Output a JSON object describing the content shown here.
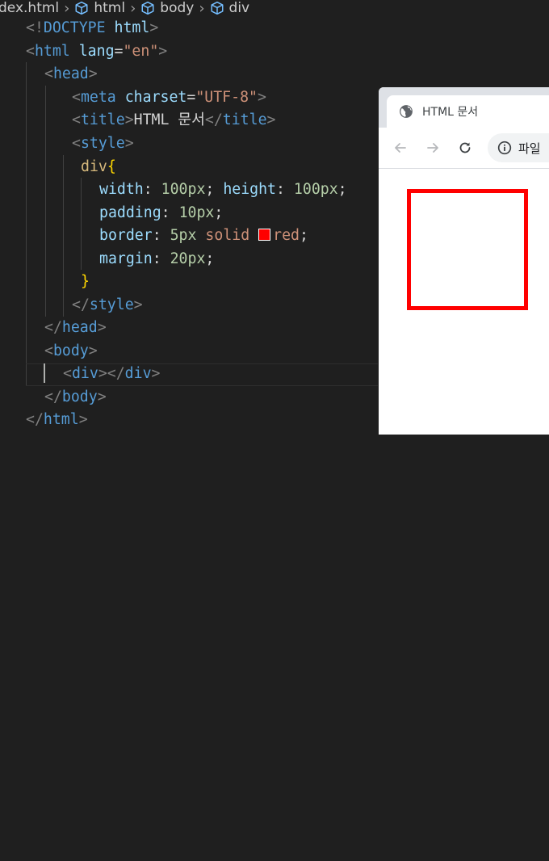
{
  "breadcrumb": {
    "file": "dex.html",
    "items": [
      "html",
      "body",
      "div"
    ]
  },
  "code": {
    "doctype_open": "<!",
    "doctype_kw": "DOCTYPE",
    "doctype_name": "html",
    "lt": "<",
    "gt": ">",
    "lt_slash": "</",
    "html_tag": "html",
    "lang_attr": "lang",
    "eq": "=",
    "lang_val": "\"en\"",
    "head_tag": "head",
    "meta_tag": "meta",
    "charset_attr": "charset",
    "charset_val": "\"UTF-8\"",
    "title_tag": "title",
    "title_text": "HTML 문서",
    "style_tag": "style",
    "css_selector": "div",
    "open_brace": "{",
    "close_brace": "}",
    "width_prop": "width",
    "height_prop": "height",
    "padding_prop": "padding",
    "border_prop": "border",
    "margin_prop": "margin",
    "colon": ":",
    "semicolon": ";",
    "v100": "100px",
    "v10": "10px",
    "v5": "5px",
    "solid": "solid",
    "red": "red",
    "v20": "20px",
    "body_tag": "body",
    "div_tag": "div",
    "swatch_color": "#ff0000"
  },
  "browser": {
    "tab_title": "HTML 문서",
    "address_text": "파일",
    "box_border_color": "#ff0000"
  },
  "icons": {
    "cube": "symbol-cube-icon",
    "globe": "globe-icon",
    "back": "back-arrow-icon",
    "forward": "forward-arrow-icon",
    "reload": "reload-icon",
    "info": "info-icon"
  }
}
